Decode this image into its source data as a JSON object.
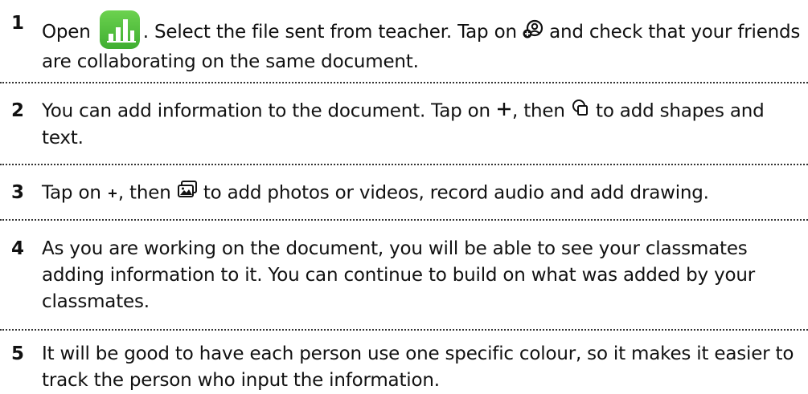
{
  "steps": [
    {
      "number": "1",
      "parts": [
        "Open",
        ". Select the file sent from teacher. Tap on",
        "and check that your friends are collaborating on the same document."
      ],
      "icons": [
        "numbers-app-icon",
        "collaborate-icon"
      ]
    },
    {
      "number": "2",
      "parts": [
        "You can add information to the document. Tap on",
        ", then",
        "to add shapes and text."
      ],
      "icons": [
        "plus-icon",
        "shapes-icon"
      ]
    },
    {
      "number": "3",
      "parts": [
        "Tap on",
        ", then",
        "to add photos or videos, record audio and add drawing."
      ],
      "icons": [
        "plus-small-icon",
        "media-icon"
      ]
    },
    {
      "number": "4",
      "text": "As you are working on the document, you will be able to see your classmates adding information to it. You can continue to build on what was added by your classmates."
    },
    {
      "number": "5",
      "text": "It will be good to have each person use one specific colour, so it makes it easier to track the person who input the information."
    }
  ],
  "colors": {
    "app_icon": "#4cbf3a",
    "text": "#111111",
    "separator": "#333333"
  }
}
